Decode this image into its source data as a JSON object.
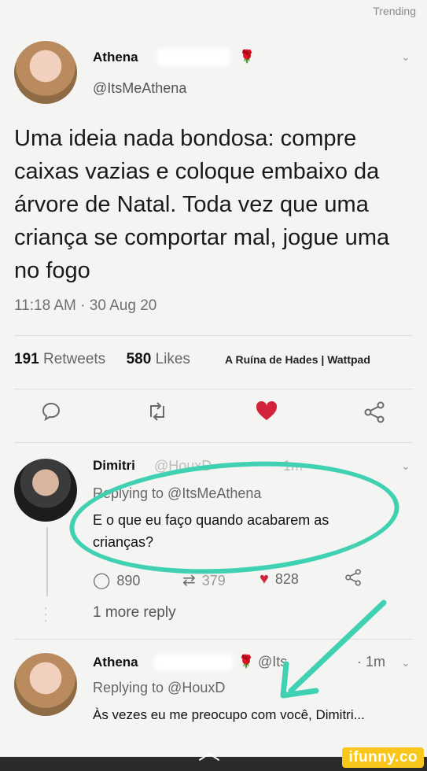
{
  "header": {
    "trending_label": "Trending"
  },
  "tweet": {
    "author_name": "Athena",
    "author_handle": "@ItsMeAthena",
    "text": "Uma ideia nada bondosa: compre caixas vazias e coloque embaixo da árvore de Natal. Toda vez que uma criança se comportar mal, jogue uma no fogo",
    "timestamp": "11:18 AM · 30 Aug 20",
    "retweets_count": "191",
    "retweets_label": "Retweets",
    "likes_count": "580",
    "likes_label": "Likes",
    "watermark_text": "A Ruína de Hades | Wattpad"
  },
  "reply1": {
    "author_name": "Dimitri",
    "author_handle": "@HouxD",
    "time": "1m",
    "replying_to": "Replying to @ItsMeAthena",
    "text": "E o que eu faço quando acabarem as crianças?",
    "reply_count": "890",
    "retweet_count": "379",
    "like_count": "828",
    "more_replies": "1 more reply"
  },
  "reply2": {
    "author_name": "Athena",
    "author_handle": "@Its",
    "time": "· 1m",
    "replying_to": "Replying to @HouxD",
    "text": "Às vezes eu me preocupo com você, Dimitri..."
  },
  "footer": {
    "brand": "ifunny.co"
  },
  "icons": {
    "reply": "speech-bubble-icon",
    "retweet": "retweet-icon",
    "like": "heart-icon",
    "share": "share-icon",
    "chevron": "chevron-down-icon",
    "rose": "rose-icon"
  },
  "colors": {
    "like_red": "#d3223c",
    "circle_teal": "#3fd1b1",
    "rose_red": "#c0172a",
    "ifunny_yellow": "#f9c61b"
  }
}
